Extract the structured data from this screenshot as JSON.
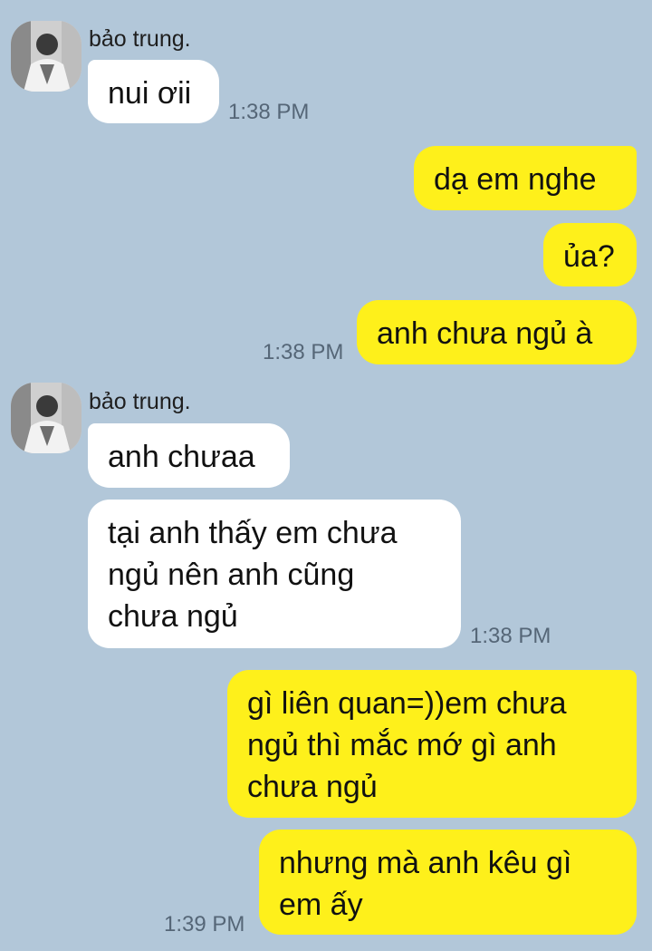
{
  "chat": {
    "groups": [
      {
        "sender": "bảo trung.",
        "messages": [
          "nui ơii"
        ],
        "time": "1:38 PM"
      },
      {
        "messages": [
          "dạ em nghe",
          "ủa?",
          "anh chưa ngủ à"
        ],
        "time": "1:38 PM"
      },
      {
        "sender": "bảo trung.",
        "messages": [
          "anh chưaa",
          "tại anh thấy em chưa\nngủ nên anh cũng\nchưa ngủ"
        ],
        "time": "1:38 PM"
      },
      {
        "messages": [
          "gì liên quan=))em chưa\nngủ thì mắc mớ gì anh\nchưa ngủ",
          "nhưng mà anh kêu gì\nem ấy"
        ],
        "time": "1:39 PM"
      }
    ]
  },
  "colors": {
    "background": "#b2c7d9",
    "incoming_bubble": "#ffffff",
    "outgoing_bubble": "#fef01b",
    "timestamp": "#556677"
  }
}
